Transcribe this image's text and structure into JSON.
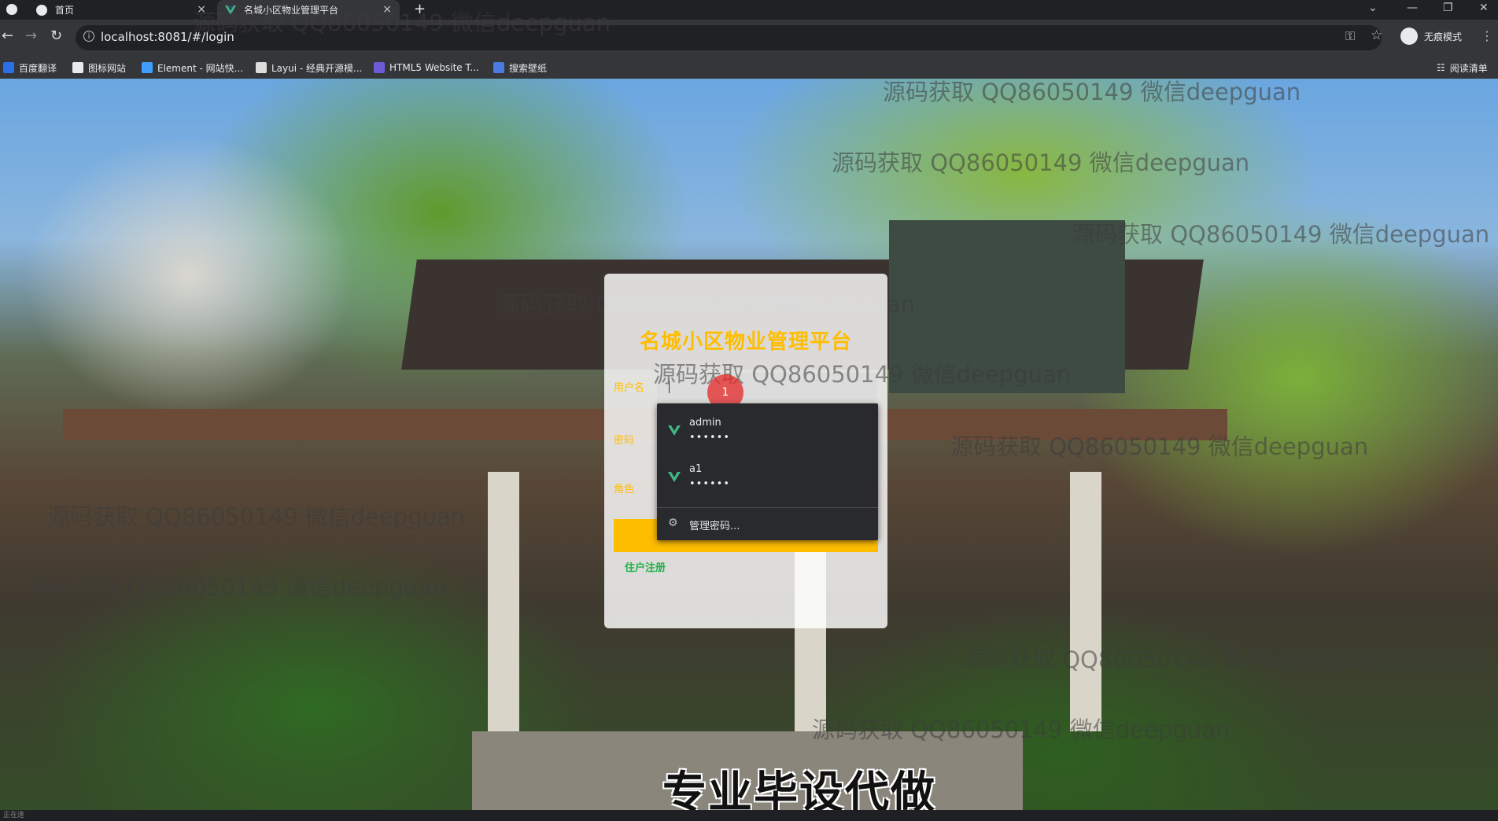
{
  "browser": {
    "tabs": [
      {
        "title": "首页"
      },
      {
        "title": "名城小区物业管理平台"
      }
    ],
    "new_tab": "+",
    "url": "localhost:8081/#/login",
    "incognito_label": "无痕模式",
    "bookmarks": [
      {
        "label": "百度翻译",
        "color": "#2a6ee8"
      },
      {
        "label": "图标网站",
        "color": "#e8eaed"
      },
      {
        "label": "Element - 网站快...",
        "color": "#409eff"
      },
      {
        "label": "Layui - 经典开源模...",
        "color": "#dcdcdc"
      },
      {
        "label": "HTML5 Website T...",
        "color": "#6b5bd6"
      },
      {
        "label": "搜索壁纸",
        "color": "#4a7be0"
      }
    ],
    "reading_list": "阅读清单"
  },
  "login": {
    "title": "名城小区物业管理平台",
    "username_label": "用户名",
    "password_label": "密码",
    "role_label": "角色",
    "register_link": "住户注册",
    "click_marker": "1"
  },
  "autofill": {
    "accounts": [
      {
        "username": "admin",
        "password": "••••••"
      },
      {
        "username": "a1",
        "password": "••••••"
      }
    ],
    "manage_label": "管理密码..."
  },
  "watermark": "源码获取 QQ86050149 微信deepguan",
  "caption": "专业毕设代做",
  "status": "正在连",
  "colors": {
    "accent": "#ffbd00",
    "link": "#20b14a",
    "vue_green": "#41b883"
  }
}
